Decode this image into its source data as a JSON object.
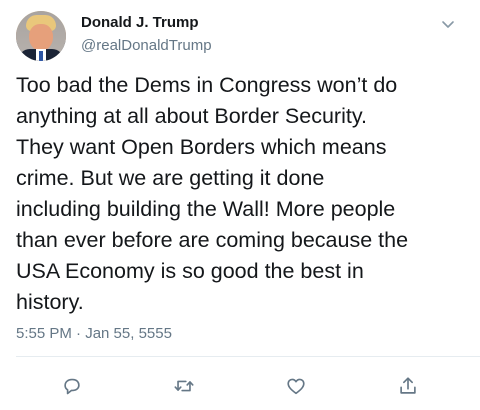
{
  "author": {
    "display_name": "Donald J. Trump",
    "handle": "@realDonaldTrump",
    "avatar_icon": "profile-photo"
  },
  "tweet": {
    "text": "Too bad the Dems in Congress won’t do\nanything at all about Border Security.\nThey want Open Borders which means\ncrime. But we are getting it done\nincluding building the Wall! More people\nthan ever before are coming because the\nUSA Economy is so good the best in\nhistory.",
    "timestamp": "5:55 PM · Jan 55, 5555"
  },
  "actions": [
    {
      "icon": "reply-icon"
    },
    {
      "icon": "retweet-icon"
    },
    {
      "icon": "like-icon"
    },
    {
      "icon": "share-icon"
    }
  ],
  "colors": {
    "text": "#14171a",
    "muted": "#657786",
    "divider": "#e6ecf0",
    "background": "#ffffff"
  }
}
